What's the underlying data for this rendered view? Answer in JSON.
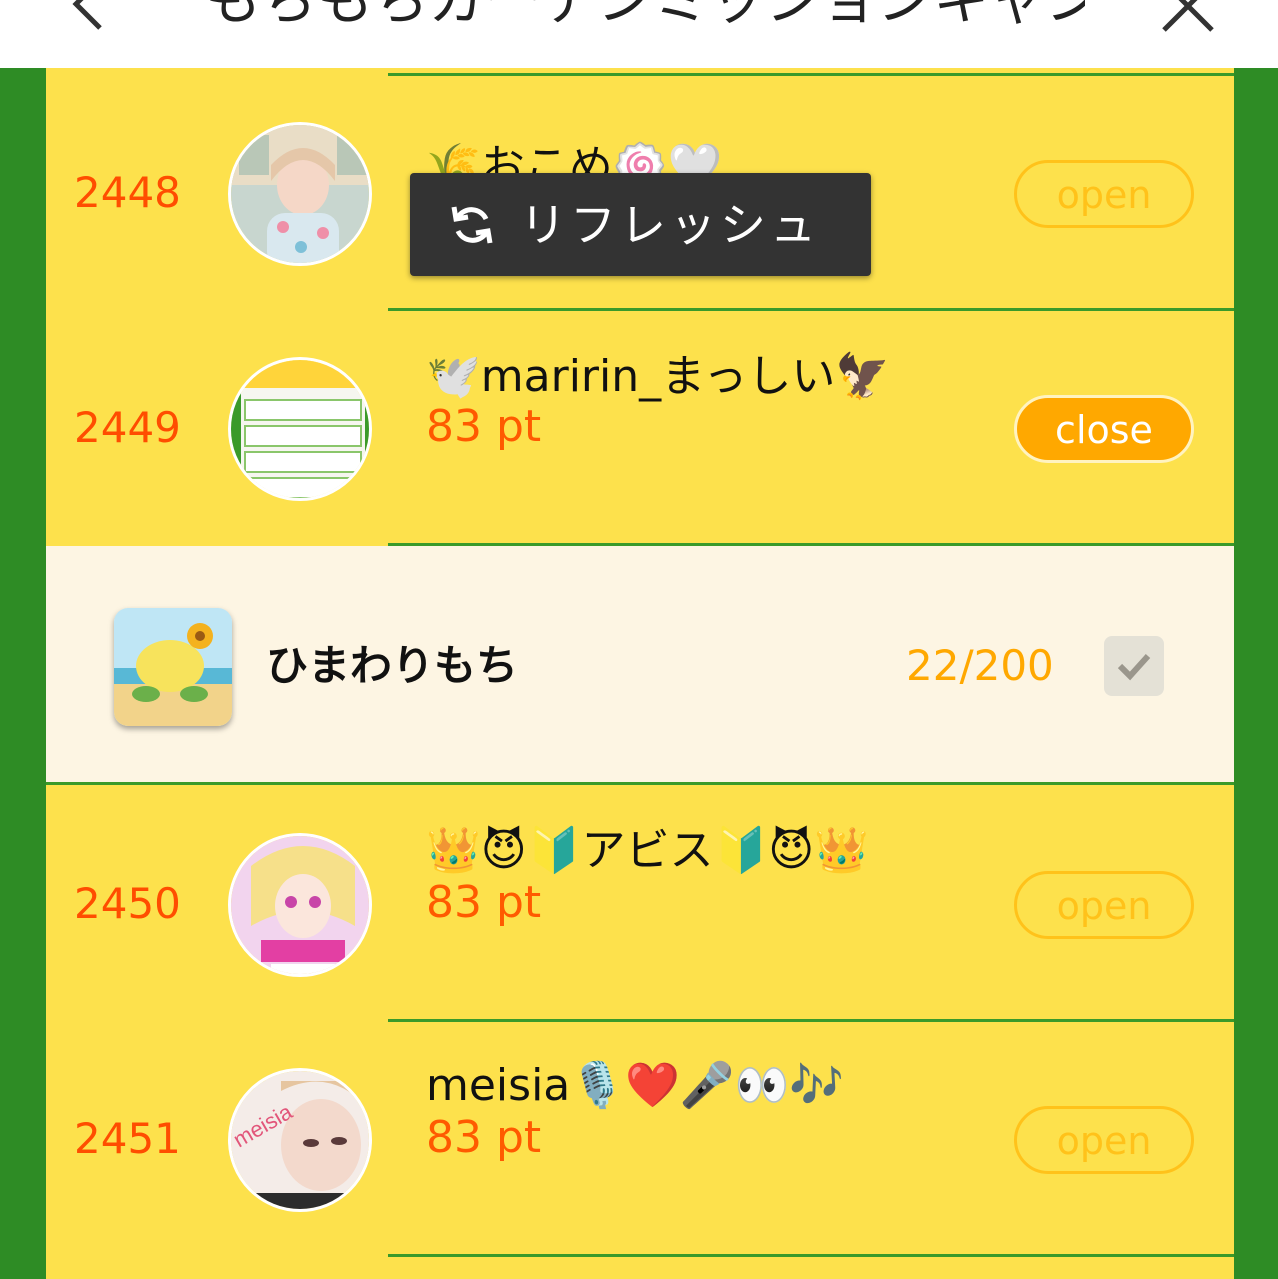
{
  "header": {
    "title": "もちもちガーデンミッションキャンペーン",
    "back_icon": "chevron-left-icon",
    "close_icon": "close-icon"
  },
  "colors": {
    "frame": "#2e8c25",
    "list_bg": "#fde14c",
    "rank": "#ff4d00",
    "points": "#ff5a00",
    "open_pill": "#ffc21a",
    "close_pill": "#ffa800",
    "sub_bg": "#fdf5e3"
  },
  "rows": [
    {
      "rank": "2448",
      "name": "🌾おこめ🍥🤍",
      "points": "",
      "action": "open"
    },
    {
      "rank": "2449",
      "name": "🕊️maririn_まっしい🦅",
      "points": "83 pt",
      "action": "close"
    },
    {
      "rank": "2450",
      "name": "👑😈🔰アビス🔰😈👑",
      "points": "83 pt",
      "action": "open"
    },
    {
      "rank": "2451",
      "name": "meisia🎙️❤️🎤👀🎶",
      "points": "83 pt",
      "action": "open"
    }
  ],
  "subitem": {
    "name": "ひまわりもち",
    "count": "22/200",
    "checked": true
  },
  "toast": {
    "icon": "refresh-icon",
    "label": "リフレッシュ"
  }
}
